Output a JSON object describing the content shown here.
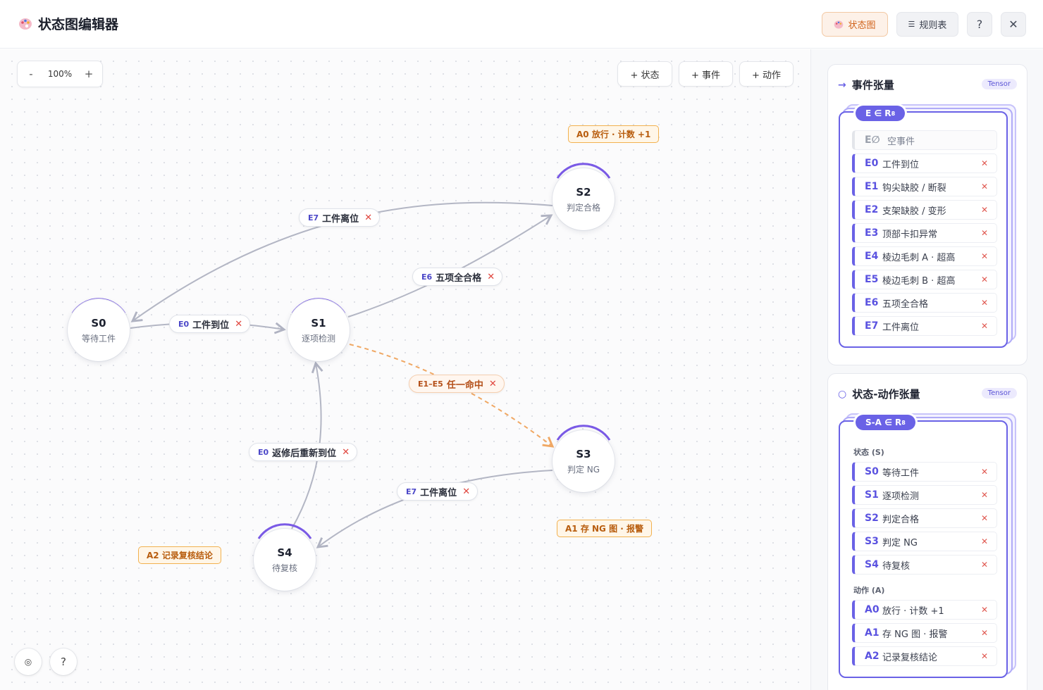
{
  "header": {
    "title": "状态图编辑器",
    "buttons": {
      "state_diagram": "状态图",
      "rule_table": "规则表",
      "help": "?",
      "close": "✕"
    }
  },
  "toolbar": {
    "zoom_out": "-",
    "zoom_level": "100%",
    "zoom_in": "+",
    "add_state": "+ 状态",
    "add_event": "+ 事件",
    "add_action": "+ 动作"
  },
  "graph": {
    "nodes": [
      {
        "id": "S0",
        "label": "等待工件"
      },
      {
        "id": "S1",
        "label": "逐项检测"
      },
      {
        "id": "S2",
        "label": "判定合格"
      },
      {
        "id": "S3",
        "label": "判定 NG"
      },
      {
        "id": "S4",
        "label": "待复核"
      }
    ],
    "edges": [
      {
        "id": "E7",
        "text": "工件离位",
        "from": "S2",
        "to": "S0"
      },
      {
        "id": "E0",
        "text": "工件到位",
        "from": "S0",
        "to": "S1"
      },
      {
        "id": "E6",
        "text": "五项全合格",
        "from": "S1",
        "to": "S2"
      },
      {
        "id": "E1–E5",
        "text": "任一命中",
        "from": "S1",
        "to": "S3"
      },
      {
        "id": "E0",
        "text": "返修后重新到位",
        "from": "S4",
        "to": "S1"
      },
      {
        "id": "E7",
        "text": "工件离位",
        "from": "S3",
        "to": "S4"
      }
    ],
    "actions": [
      {
        "text": "A0 放行 · 计数 +1"
      },
      {
        "text": "A1 存 NG 图 · 报警"
      },
      {
        "text": "A2 记录复核结论"
      }
    ],
    "edge_remove": "✕"
  },
  "fabs": {
    "locate": "◎",
    "help": "?"
  },
  "event_tensor": {
    "title": "事件张量",
    "badge": "Tensor",
    "tag": "E ∈ R",
    "tag_sup": "8",
    "null_event": {
      "id": "E∅",
      "label": "空事件"
    },
    "events": [
      {
        "id": "E0",
        "label": "工件到位"
      },
      {
        "id": "E1",
        "label": "钩尖缺胶 / 断裂"
      },
      {
        "id": "E2",
        "label": "支架缺胶 / 变形"
      },
      {
        "id": "E3",
        "label": "顶部卡扣异常"
      },
      {
        "id": "E4",
        "label": "棱边毛刺 A · 超高"
      },
      {
        "id": "E5",
        "label": "棱边毛刺 B · 超高"
      },
      {
        "id": "E6",
        "label": "五项全合格"
      },
      {
        "id": "E7",
        "label": "工件离位"
      }
    ]
  },
  "state_action_tensor": {
    "title": "状态-动作张量",
    "badge": "Tensor",
    "tag": "S-A ∈ R",
    "tag_sup": "8",
    "states_label": "状态 (S)",
    "actions_label": "动作 (A)",
    "states": [
      {
        "id": "S0",
        "label": "等待工件"
      },
      {
        "id": "S1",
        "label": "逐项检测"
      },
      {
        "id": "S2",
        "label": "判定合格"
      },
      {
        "id": "S3",
        "label": "判定 NG"
      },
      {
        "id": "S4",
        "label": "待复核"
      }
    ],
    "actions": [
      {
        "id": "A0",
        "label": "放行 · 计数 +1"
      },
      {
        "id": "A1",
        "label": "存 NG 图 · 报警"
      },
      {
        "id": "A2",
        "label": "记录复核结论"
      }
    ],
    "remove": "✕"
  },
  "colors": {
    "accent": "#6a62e6",
    "edge": "#b3b6c4",
    "edge_ng": "#f0a864",
    "action_border": "#f2b14f",
    "remove": "#e0453d"
  }
}
